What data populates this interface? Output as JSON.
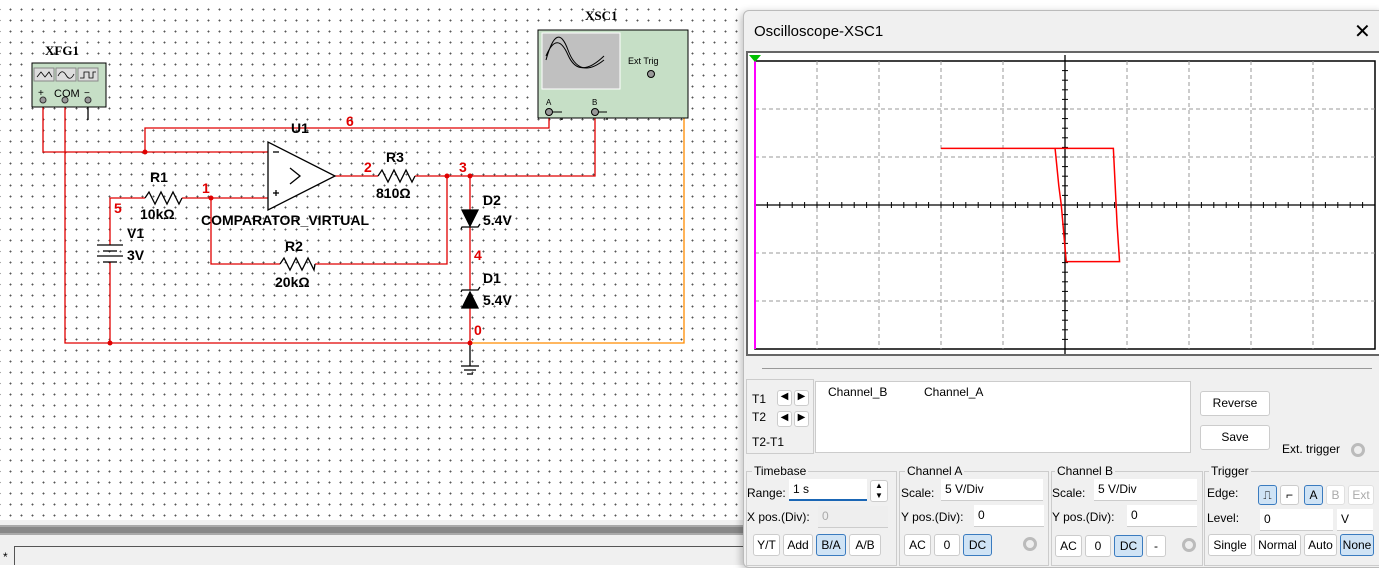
{
  "schematic": {
    "labels": {
      "xfg1": "XFG1",
      "xsc1": "XSC1",
      "u1": "U1",
      "opamp_model": "COMPARATOR_VIRTUAL",
      "r1": "R1",
      "r1_value": "10kΩ",
      "r2": "R2",
      "r2_value": "20kΩ",
      "r3": "R3",
      "r3_value": "810Ω",
      "v1": "V1",
      "v1_value": "3V",
      "d1": "D1",
      "d1_value": "5.4V",
      "d2": "D2",
      "d2_value": "5.4V",
      "ext_trig": "Ext Trig",
      "ch_a": "A",
      "ch_b": "B",
      "com": "COM"
    },
    "nodes": [
      "6",
      "2",
      "3",
      "1",
      "5",
      "4",
      "0"
    ],
    "wire_color": "#e00000",
    "ext_wire_color": "#ff8c00",
    "instrument_color": "#c6dfc6"
  },
  "command_prompt": "*",
  "oscilloscope": {
    "title": "Oscilloscope-XSC1",
    "close_icon": "close-icon",
    "cursors": {
      "t1": "T1",
      "t2": "T2",
      "t2_t1": "T2-T1",
      "headers": [
        "Channel_B",
        "Channel_A"
      ]
    },
    "reverse": "Reverse",
    "save": "Save",
    "ext_trigger": "Ext. trigger",
    "timebase": {
      "title": "Timebase",
      "range_label": "Range:",
      "range_value": "1  s",
      "xpos_label": "X pos.(Div):",
      "xpos_value": "0",
      "modes": [
        "Y/T",
        "Add",
        "B/A",
        "A/B"
      ],
      "active_mode": "B/A"
    },
    "channel_a": {
      "title": "Channel A",
      "scale_label": "Scale:",
      "scale_value": "5  V/Div",
      "ypos_label": "Y pos.(Div):",
      "ypos_value": "0",
      "coupling": [
        "AC",
        "0",
        "DC"
      ],
      "active": "DC"
    },
    "channel_b": {
      "title": "Channel B",
      "scale_label": "Scale:",
      "scale_value": "5  V/Div",
      "ypos_label": "Y pos.(Div):",
      "ypos_value": "0",
      "coupling": [
        "AC",
        "0",
        "DC",
        "-"
      ],
      "active": "DC"
    },
    "trigger": {
      "title": "Trigger",
      "edge_label": "Edge:",
      "edges": [
        "rising",
        "falling"
      ],
      "sources": [
        "A",
        "B",
        "Ext"
      ],
      "active_source": "A",
      "level_label": "Level:",
      "level_value": "0",
      "level_unit": "V",
      "modes": [
        "Single",
        "Normal",
        "Auto",
        "None"
      ],
      "active_mode": "None"
    }
  },
  "chart_data": {
    "type": "line",
    "mode": "B/A (X = Channel A, Y = Channel B)",
    "xlim": [
      -25,
      25
    ],
    "ylim": [
      -15,
      15
    ],
    "x_div": 5,
    "y_div": 5,
    "grid": true,
    "series": [
      {
        "color": "#ff0000",
        "x": [
          -10,
          -0.8,
          -0.5,
          -0.3,
          0.1,
          0.1,
          4.4,
          4.2,
          3.9,
          -0.8,
          -10
        ],
        "y": [
          5.9,
          5.9,
          2,
          0,
          -5.9,
          -5.9,
          -5.9,
          -2,
          5.9,
          5.9,
          5.9
        ]
      }
    ]
  }
}
